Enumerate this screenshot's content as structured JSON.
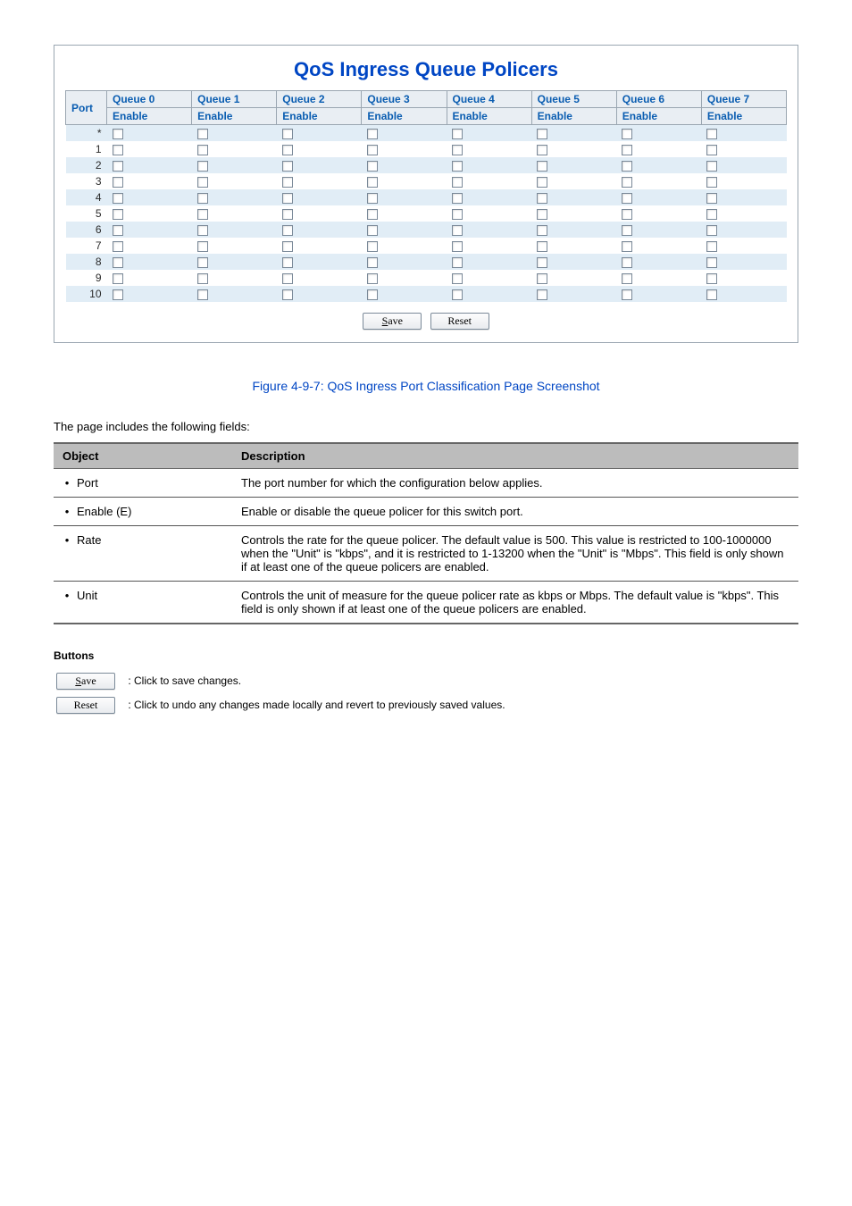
{
  "figure": {
    "title": "QoS Ingress Queue Policers",
    "port_header": "Port",
    "queue_headers": [
      "Queue 0",
      "Queue 1",
      "Queue 2",
      "Queue 3",
      "Queue 4",
      "Queue 5",
      "Queue 6",
      "Queue 7"
    ],
    "sub_header": "Enable",
    "ports": [
      "*",
      "1",
      "2",
      "3",
      "4",
      "5",
      "6",
      "7",
      "8",
      "9",
      "10"
    ],
    "save": "Save",
    "reset": "Reset"
  },
  "caption": "Figure 4-9-7: QoS Ingress Port Classification Page Screenshot",
  "desc_intro": "The page includes the following fields:",
  "desc": {
    "head_obj": "Object",
    "head_desc": "Description",
    "rows": [
      {
        "obj": "Port",
        "desc": "The port number for which the configuration below applies."
      },
      {
        "obj": "Enable (E)",
        "desc": "Enable or disable the queue policer for this switch port."
      },
      {
        "obj": "Rate",
        "desc": "Controls the rate for the queue policer. The default value is 500. This value is restricted to 100-1000000 when the \"Unit\" is \"kbps\", and it is restricted to 1-13200 when the \"Unit\" is \"Mbps\". This field is only shown if at least one of the queue policers are enabled."
      },
      {
        "obj": "Unit",
        "desc": "Controls the unit of measure for the queue policer rate as kbps or Mbps. The default value is \"kbps\". This field is only shown if at least one of the queue policers are enabled."
      }
    ]
  },
  "buttons": {
    "label": "Buttons",
    "save": "Save",
    "save_desc": ": Click to save changes.",
    "reset": "Reset",
    "reset_desc": ": Click to undo any changes made locally and revert to previously saved values."
  }
}
